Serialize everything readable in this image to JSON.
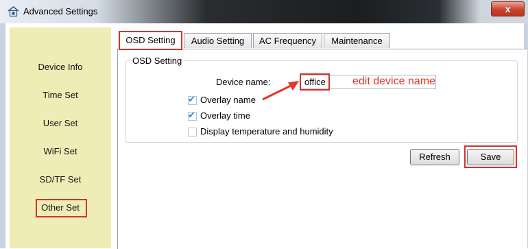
{
  "window": {
    "title": "Advanced Settings",
    "close_glyph": "x"
  },
  "sidebar": {
    "items": [
      {
        "label": "Device Info"
      },
      {
        "label": "Time Set"
      },
      {
        "label": "User Set"
      },
      {
        "label": "WiFi Set"
      },
      {
        "label": "SD/TF Set"
      },
      {
        "label": "Other Set",
        "selected": true
      }
    ]
  },
  "tabs": [
    {
      "label": "OSD Setting",
      "active": true
    },
    {
      "label": "Audio Setting"
    },
    {
      "label": "AC Frequency"
    },
    {
      "label": "Maintenance"
    }
  ],
  "osd": {
    "group_title": "OSD Setting",
    "device_name_label": "Device name:",
    "device_name_value": "office",
    "checkboxes": [
      {
        "label": "Overlay name",
        "checked": true
      },
      {
        "label": "Overlay time",
        "checked": true
      },
      {
        "label": "Display temperature and humidity",
        "checked": false
      }
    ]
  },
  "annotation": {
    "text": "edit device name",
    "color": "#e8332a"
  },
  "buttons": {
    "refresh": "Refresh",
    "save": "Save"
  },
  "colors": {
    "highlight": "#d9302a",
    "sidebar_bg": "#efedb6",
    "check": "#2f86d8"
  }
}
